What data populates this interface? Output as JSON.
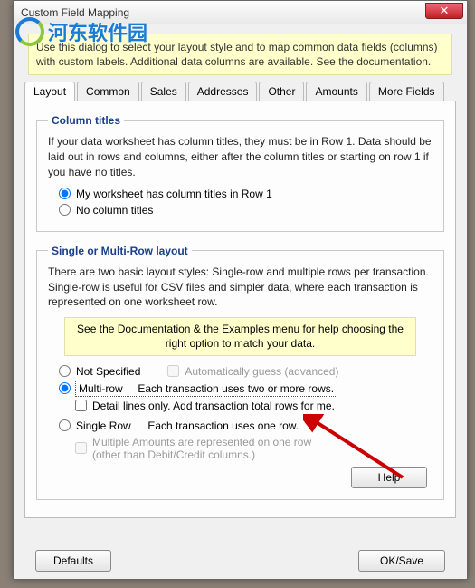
{
  "window": {
    "title": "Custom Field Mapping",
    "close": "✕"
  },
  "watermark": "河东软件园",
  "intro": "Use this dialog to select your layout style and to map common data fields (columns) with custom labels. Additional data columns are available. See the documentation.",
  "tabs": {
    "layout": "Layout",
    "common": "Common",
    "sales": "Sales",
    "addresses": "Addresses",
    "other": "Other",
    "amounts": "Amounts",
    "more": "More Fields"
  },
  "column_titles": {
    "legend": "Column titles",
    "desc": "If your data worksheet has column titles, they must be in Row 1. Data should be laid out in rows and columns, either after the column titles or starting on row 1 if you have no titles.",
    "opt_has_titles": "My worksheet has column titles in Row 1",
    "opt_no_titles": "No column titles"
  },
  "layout_group": {
    "legend": "Single or Multi-Row layout",
    "desc": "There are two basic layout styles: Single-row and multiple rows per transaction. Single-row is useful for CSV files and simpler data, where each transaction is represented on one worksheet row.",
    "note": "See the Documentation & the Examples menu for help choosing the right option to match your data.",
    "opt_not_specified": "Not Specified",
    "chk_auto_guess": "Automatically guess (advanced)",
    "opt_multi": "Multi-row",
    "multi_hint": "Each transaction uses two or more rows.",
    "chk_detail": "Detail lines only. Add transaction total rows for me.",
    "opt_single": "Single Row",
    "single_hint": "Each transaction uses one row.",
    "chk_multiple_amounts_l1": "Multiple Amounts are represented on one row",
    "chk_multiple_amounts_l2": "(other than Debit/Credit columns.)"
  },
  "buttons": {
    "help": "Help",
    "defaults": "Defaults",
    "ok": "OK/Save"
  }
}
